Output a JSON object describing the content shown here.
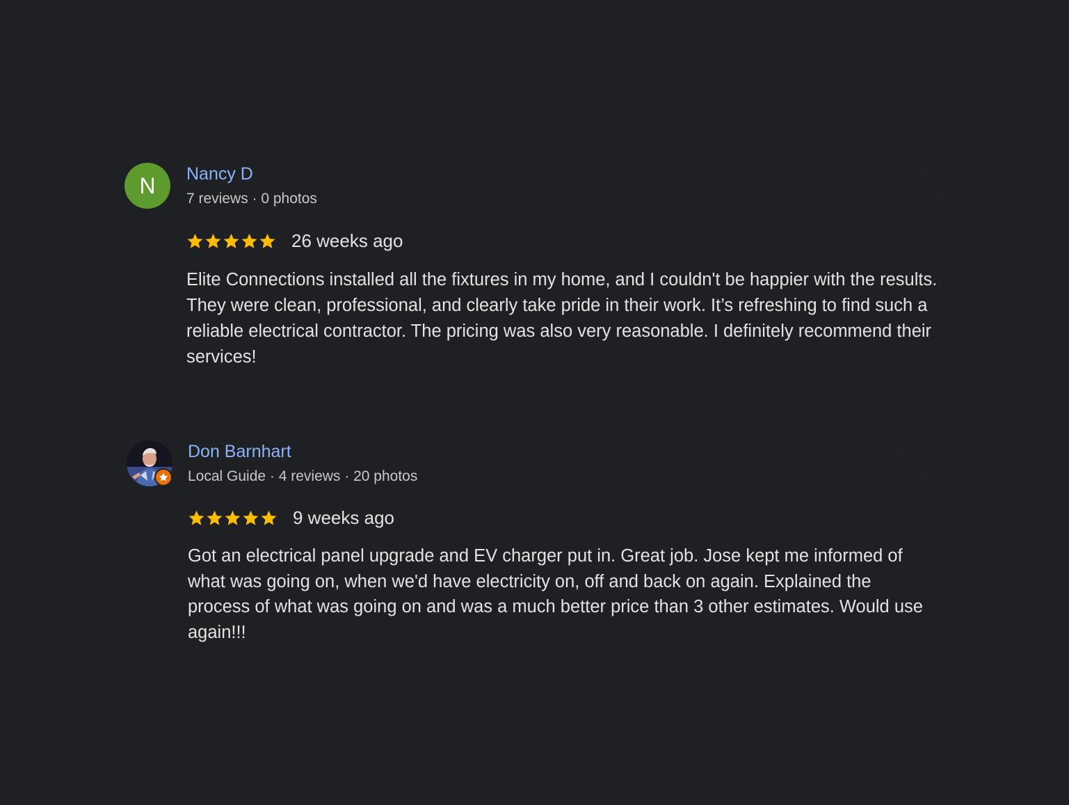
{
  "colors": {
    "background": "#1f2024",
    "author_link": "#8ab4f8",
    "star": "#fbbc04",
    "avatar_n": "#5e9b2f",
    "local_guide_badge": "#e8710a"
  },
  "reviews": [
    {
      "avatar": {
        "type": "letter",
        "letter": "N"
      },
      "author_name": "Nancy D",
      "author_meta": "7 reviews · 0 photos",
      "rating": 5,
      "rating_max": 5,
      "date": "26 weeks ago",
      "text": "Elite Connections installed all the fixtures in my home, and I couldn't be happier with the results. They were clean, professional, and clearly take pride in their work. It’s refreshing to find such a reliable electrical contractor. The pricing was also very reasonable. I definitely recommend their services!"
    },
    {
      "avatar": {
        "type": "photo",
        "badge_icon": "local-guide-star-icon"
      },
      "author_name": "Don Barnhart",
      "author_meta": "Local Guide · 4 reviews · 20 photos",
      "rating": 5,
      "rating_max": 5,
      "date": "9 weeks ago",
      "text": "Got an electrical panel upgrade and EV charger put in. Great job. Jose kept me informed of what was going on, when we'd have electricity on, off and back on again. Explained the process of what was going on and was a much better price than 3 other estimates. Would use again!!!"
    }
  ]
}
